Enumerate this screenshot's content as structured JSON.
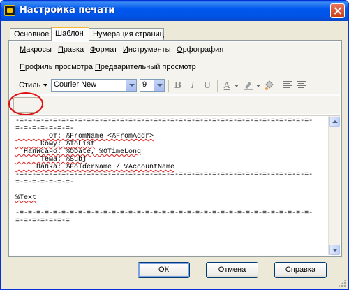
{
  "window": {
    "title": "Настройка печати"
  },
  "tabs": [
    {
      "label": "Основное",
      "active": false
    },
    {
      "label": "Шаблон",
      "active": true
    },
    {
      "label": "Нумерация страниц",
      "active": false
    }
  ],
  "menu_toolbar": {
    "items": [
      {
        "accel": "М",
        "rest": "акросы"
      },
      {
        "accel": "П",
        "rest": "равка"
      },
      {
        "accel": "Ф",
        "rest": "ормат"
      },
      {
        "accel": "И",
        "rest": "нструменты"
      },
      {
        "accel": "О",
        "rest": "рфография"
      }
    ]
  },
  "view_toolbar": {
    "items": [
      {
        "accel": "П",
        "rest": "рофиль просмотра"
      },
      {
        "accel": "П",
        "rest": "редварительный просмотр"
      }
    ]
  },
  "format_toolbar": {
    "style_label": "Стиль",
    "font_name": "Courier New",
    "font_size": "9",
    "bold_label": "B",
    "italic_label": "I",
    "underline_label": "U",
    "font_color_label": "A"
  },
  "editor": {
    "lines": [
      "-=-=-=-=-=-=-=-=-=-=-=-=-=-=-=-=-=-=-=-=-=-=-=-=-=-=-=-=-=-=-=-=-=-=-=-",
      "=-=-=-=-=-=-=-",
      "        От: %FromName <%FromAddr>",
      "      Кому: %ToList",
      "  Написано: %ODate, %OTimeLong",
      "      Тема: %Subj",
      "     Папка: %FolderName / %AccountName",
      "-=-=-=-=-=-=-=-=-=-=-=-=-=-=-=-=-=-=-=-=-=-=-=-=-=-=-=-=-=-=-=-=-=-=-=-",
      "=-=-=-=-=-=-=-",
      "",
      "%Text",
      "",
      "-=-=-=-=-=-=-=-=-=-=-=-=-=-=-=-=-=-=-=-=-=-=-=-=-=-=-=-=-=-=-=-=-=-=-=-",
      "=-=-=-=-=-=-="
    ]
  },
  "buttons": {
    "ok_accel": "О",
    "ok_rest": "К",
    "cancel": "Отмена",
    "help": "Справка"
  },
  "colors": {
    "titlebar": "#0058ee",
    "annotation_circle": "#e01010",
    "spell_underline": "#e02020"
  }
}
